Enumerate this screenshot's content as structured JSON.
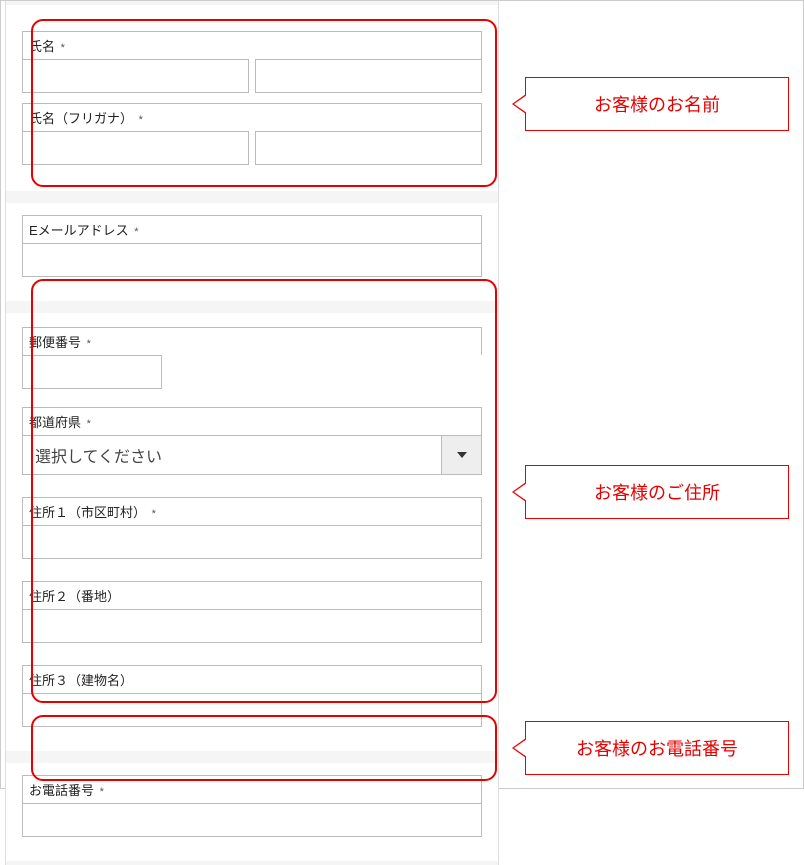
{
  "callouts": {
    "name": "お客様のお名前",
    "address": "お客様のご住所",
    "phone": "お客様のお電話番号"
  },
  "fields": {
    "name": {
      "label": "氏名",
      "required": "*"
    },
    "name_kana": {
      "label": "氏名（フリガナ）",
      "required": "*"
    },
    "email": {
      "label": "Eメールアドレス",
      "required": "*"
    },
    "postal": {
      "label": "郵便番号",
      "required": "*"
    },
    "prefecture": {
      "label": "都道府県",
      "required": "*",
      "selected": "選択してください"
    },
    "addr1": {
      "label": "住所１（市区町村）",
      "required": "*"
    },
    "addr2": {
      "label": "住所２（番地）"
    },
    "addr3": {
      "label": "住所３（建物名）"
    },
    "phone": {
      "label": "お電話番号",
      "required": "*"
    }
  }
}
